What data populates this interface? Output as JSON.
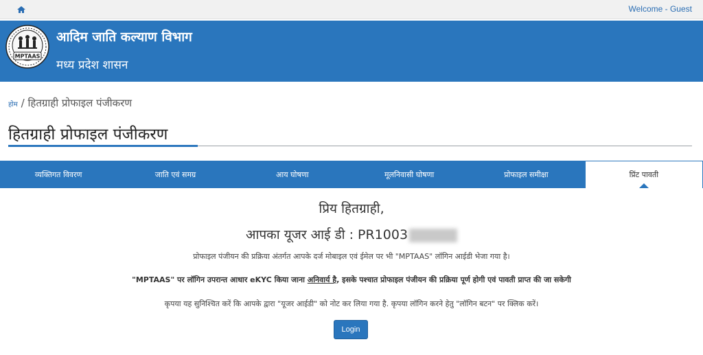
{
  "topbar": {
    "home_icon": "home-icon",
    "welcome": "Welcome - Guest"
  },
  "header": {
    "logo_text": "MPTAAS",
    "department": "आदिम जाति कल्याण विभाग",
    "government": "मध्य प्रदेश शासन"
  },
  "breadcrumb": {
    "home": "होम",
    "separator": "/",
    "current": "हितग्राही प्रोफाइल पंजीकरण"
  },
  "page_title": "हितग्राही प्रोफाइल पंजीकरण",
  "tabs": [
    {
      "label": "व्यक्तिगत विवरण"
    },
    {
      "label": "जाति एवं समग्र"
    },
    {
      "label": "आय घोषणा"
    },
    {
      "label": "मूलनिवासी घोषणा"
    },
    {
      "label": "प्रोफाइल समीक्षा"
    },
    {
      "label": "प्रिंट पावती",
      "active": true
    }
  ],
  "main": {
    "greeting": "प्रिय हितग्राही,",
    "userid_label": "आपका यूजर आई डी : ",
    "userid_value": "PR1003",
    "info1": "प्रोफाइल पंजीयन की प्रक्रिया अंतर्गत आपके दर्ज मोबाइल एवं ईमेल पर भी \"MPTAAS\" लॉगिन आईडी भेजा गया है।",
    "info2_a": "\"MPTAAS\" पर लॉगिन उपरान्त आधार eKYC किया जाना ",
    "info2_b": "अनिवार्य है",
    "info2_c": ", इसके पश्चात प्रोफाइल पंजीयन की प्रक्रिया पूर्ण होगी एवं पावती प्राप्त की जा सकेगी",
    "info3": "कृपया यह सुनिश्चित करें कि आपके द्वारा \"यूजर आईडी\" को नोट कर लिया गया है. कृपया लॉगिन करने हेतु \"लॉगिन बटन\" पर क्लिक करें।",
    "login_label": "Login"
  },
  "colors": {
    "primary": "#2a76bd",
    "topbar": "#f1f1f1"
  }
}
